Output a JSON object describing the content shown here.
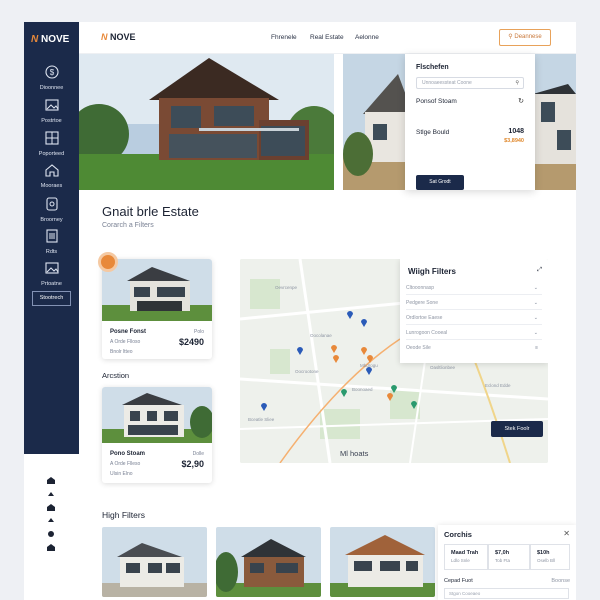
{
  "brand": {
    "logo_mark": "N",
    "logo_text": "NOVE",
    "accent": "#e8893a",
    "navy": "#1b2a4a"
  },
  "sidebar": {
    "items": [
      {
        "icon": "dollar-icon",
        "label": "Dioonnee"
      },
      {
        "icon": "image-icon",
        "label": "Postrtoe"
      },
      {
        "icon": "grid-icon",
        "label": "Poporteed"
      },
      {
        "icon": "home-icon",
        "label": "Mooraes"
      },
      {
        "icon": "tag-icon",
        "label": "Broorney"
      },
      {
        "icon": "list-icon",
        "label": "Rdts"
      },
      {
        "icon": "image-icon",
        "label": "Prtoatne"
      }
    ],
    "button_label": "Stootrech"
  },
  "topbar": {
    "logo_text": "NOVE",
    "nav": [
      "Fhrenele",
      "Real Estate",
      "Aelonne"
    ],
    "button_label": "Deannese"
  },
  "hero_filter": {
    "title": "Flschefen",
    "search_placeholder": "Unnoaeessteat Coone",
    "row1_label": "Ponsof Stoam",
    "row2_label": "Stlge Bould",
    "row2_value": "1048",
    "row2_sub": "$3,8940",
    "button_label": "Sat Grodt"
  },
  "heading": {
    "title": "Gnait brle Estate",
    "subtitle": "Corarch a Filters"
  },
  "cards": [
    {
      "name": "Posne Fonst",
      "name_right": "Polo",
      "addr": "A Orde Flloso",
      "price": "$2490",
      "tag": "Bnolr ltteo"
    },
    {
      "name": "Pono Stoam",
      "name_right": "Dolle",
      "addr": "A Orde Flleso",
      "price": "$2,90",
      "tag": "Ulsin Elno"
    }
  ],
  "section_label": "Arcstion",
  "map": {
    "panel_title": "Wiigh Filters",
    "rows": [
      "Cltooonnasp",
      "Pedgere Sone",
      "Ordlortoe Eaese",
      "Lunrogoon Cooeal",
      "Oeode Sile"
    ],
    "button_label": "Stek Foolr",
    "footer_label": "Ml hoats",
    "place_labels": [
      "Oevrcenpe",
      "Oocolanae",
      "Mbdrogu",
      "Oocrootone",
      "Boonoaed",
      "Bceatle Sliee",
      "Oasltlionbee",
      "Eclond Edde"
    ]
  },
  "bottom": {
    "title": "High Filters"
  },
  "compare": {
    "title": "Corchis",
    "boxes": [
      {
        "title": "Maad Trah",
        "sub": "Ldlo Snle"
      },
      {
        "title": "$7,0h",
        "sub": "Tob Fta"
      },
      {
        "title": "$10h",
        "sub": "Oselb Bll"
      }
    ],
    "row_label": "Cepad Fuot",
    "row_value": "Boonse",
    "input_placeholder": "Stgon Cooeaeo"
  }
}
